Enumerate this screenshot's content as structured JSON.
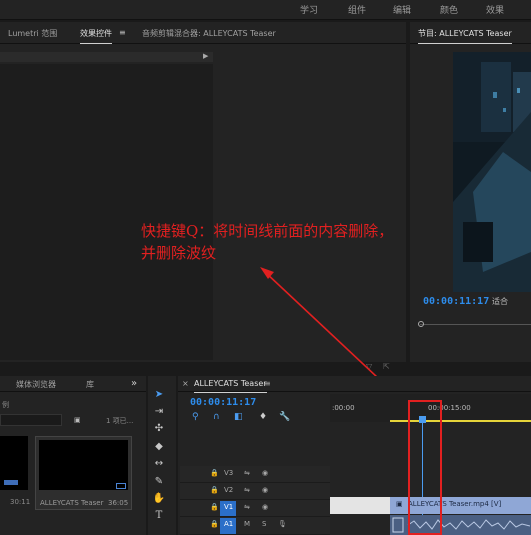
{
  "workspaces": [
    "学习",
    "组件",
    "编辑",
    "颜色",
    "效果"
  ],
  "source_panel": {
    "tabs": [
      "Lumetri 范围",
      "效果控件",
      "音频剪辑混合器: ALLEYCATS Teaser"
    ],
    "menu_icon": "menu-icon"
  },
  "program_monitor": {
    "title": "节目: ALLEYCATS Teaser",
    "timecode": "00:00:11:17",
    "fit_label": "适合"
  },
  "project_panel": {
    "tabs": [
      "媒体浏览器",
      "库"
    ],
    "item_count": "1 项已...",
    "clip_name": "ALLEYCATS Teaser",
    "clip_duration": "36:05",
    "thumb_duration": "30:11",
    "side_label": "例"
  },
  "timeline": {
    "sequence_name": "ALLEYCATS Teaser",
    "timecode": "00:00:11:17",
    "ruler_start": ":00:00",
    "ruler_mark": "00:00:15:00",
    "tracks": [
      {
        "name": "V3"
      },
      {
        "name": "V2"
      },
      {
        "name": "V1"
      },
      {
        "name": "A1",
        "m": "M",
        "s": "S"
      }
    ],
    "clip_label": "ALLEYCATS Teaser.mp4 [V]"
  },
  "annotation": {
    "line1": "快捷键Q：将时间线前面的内容删除，",
    "line2": "并删除波纹"
  },
  "colors": {
    "accent": "#2d8ceb",
    "annotation": "#e12020",
    "clip_video": "#8fa7d6",
    "work_area": "#e6d43a"
  }
}
